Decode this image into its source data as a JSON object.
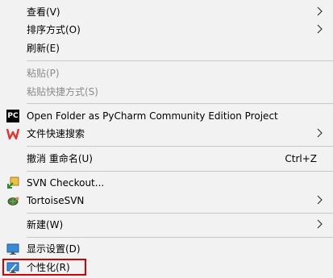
{
  "menu": {
    "items": {
      "view": {
        "label": "查看(V)"
      },
      "sort_by": {
        "label": "排序方式(O)"
      },
      "refresh": {
        "label": "刷新(E)"
      },
      "paste": {
        "label": "粘贴(P)"
      },
      "paste_shortcut": {
        "label": "粘贴快捷方式(S)"
      },
      "pycharm": {
        "label": "Open Folder as PyCharm Community Edition Project",
        "icon": "pycharm-icon"
      },
      "file_search": {
        "label": "文件快速搜索",
        "icon": "wps-icon"
      },
      "undo_rename": {
        "label": "撤消 重命名(U)",
        "shortcut": "Ctrl+Z"
      },
      "svn_checkout": {
        "label": "SVN Checkout...",
        "icon": "svn-checkout-icon"
      },
      "tortoise_svn": {
        "label": "TortoiseSVN",
        "icon": "tortoisesvn-icon"
      },
      "new": {
        "label": "新建(W)"
      },
      "display_settings": {
        "label": "显示设置(D)",
        "icon": "display-icon"
      },
      "personalize": {
        "label": "个性化(R)",
        "icon": "personalize-icon"
      }
    }
  },
  "colors": {
    "menu_background": "#f2f2f2",
    "disabled_text": "#8c8c8c",
    "separator": "#c8c8c8",
    "highlight_border": "#d20000"
  }
}
